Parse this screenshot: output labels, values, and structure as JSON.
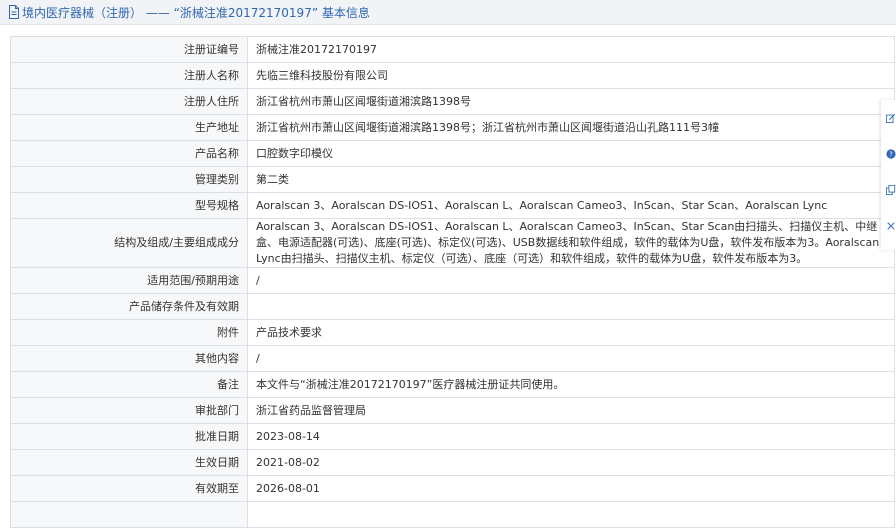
{
  "header": {
    "title": "境内医疗器械（注册） —— “浙械注准20172170197” 基本信息"
  },
  "rows": [
    {
      "label": "注册证编号",
      "value": "浙械注准20172170197"
    },
    {
      "label": "注册人名称",
      "value": "先临三维科技股份有限公司"
    },
    {
      "label": "注册人住所",
      "value": "浙江省杭州市萧山区闻堰街道湘滨路1398号"
    },
    {
      "label": "生产地址",
      "value": "浙江省杭州市萧山区闻堰街道湘滨路1398号；浙江省杭州市萧山区闻堰街道沿山孔路111号3幢"
    },
    {
      "label": "产品名称",
      "value": "口腔数字印模仪"
    },
    {
      "label": "管理类别",
      "value": "第二类"
    },
    {
      "label": "型号规格",
      "value": "Aoralscan 3、Aoralscan DS-IOS1、Aoralscan L、Aoralscan Cameo3、InScan、Star Scan、Aoralscan Lync"
    },
    {
      "label": "结构及组成/主要组成成分",
      "value": "Aoralscan 3、Aoralscan DS-IOS1、Aoralscan L、Aoralscan Cameo3、InScan、Star Scan由扫描头、扫描仪主机、中继盒、电源适配器(可选)、底座(可选)、标定仪(可选)、USB数据线和软件组成，软件的载体为U盘，软件发布版本为3。Aoralscan Lync由扫描头、扫描仪主机、标定仪（可选）、底座（可选）和软件组成，软件的载体为U盘，软件发布版本为3。"
    },
    {
      "label": "适用范围/预期用途",
      "value": "/"
    },
    {
      "label": "产品储存条件及有效期",
      "value": ""
    },
    {
      "label": "附件",
      "value": "产品技术要求"
    },
    {
      "label": "其他内容",
      "value": "/"
    },
    {
      "label": "备注",
      "value": "本文件与“浙械注准20172170197”医疗器械注册证共同使用。"
    },
    {
      "label": "审批部门",
      "value": "浙江省药品监督管理局"
    },
    {
      "label": "批准日期",
      "value": "2023-08-14"
    },
    {
      "label": "生效日期",
      "value": "2021-08-02"
    },
    {
      "label": "有效期至",
      "value": "2026-08-01"
    },
    {
      "label": "",
      "value": ""
    }
  ],
  "side_rail": {
    "icons": [
      "edit-icon",
      "help-icon",
      "copy-icon",
      "close-icon"
    ]
  },
  "colors": {
    "accent": "#2f67b2",
    "label_bg": "#f7f8fa",
    "border": "#dcdfe6"
  }
}
